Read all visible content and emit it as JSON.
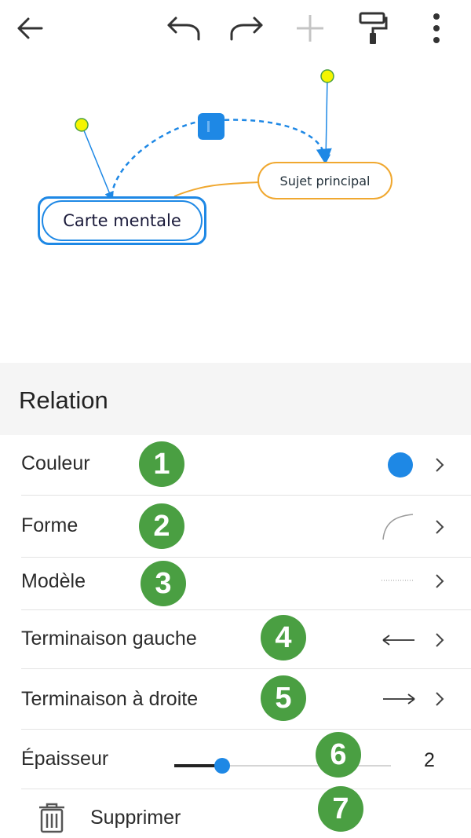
{
  "colors": {
    "accent": "#1e88e5",
    "topic_border": "#f0a830",
    "badge": "#4a9f42"
  },
  "toolbar": {
    "icons": [
      "arrow-left-icon",
      "undo-icon",
      "redo-icon",
      "plus-icon",
      "format-painter-icon",
      "more-vertical-icon"
    ]
  },
  "canvas": {
    "central_topic": "Carte mentale",
    "main_topic": "Sujet principal"
  },
  "panel": {
    "title": "Relation",
    "rows": {
      "couleur": {
        "label": "Couleur",
        "value_color": "#1e88e5",
        "badge": "1"
      },
      "forme": {
        "label": "Forme",
        "badge": "2"
      },
      "modele": {
        "label": "Modèle",
        "badge": "3"
      },
      "terminaison_gauche": {
        "label": "Terminaison gauche",
        "badge": "4"
      },
      "terminaison_droite": {
        "label": "Terminaison à droite",
        "badge": "5"
      },
      "epaisseur": {
        "label": "Épaisseur",
        "value": "2",
        "badge": "6",
        "slider_fraction": 0.22
      },
      "supprimer": {
        "label": "Supprimer",
        "badge": "7"
      }
    }
  }
}
